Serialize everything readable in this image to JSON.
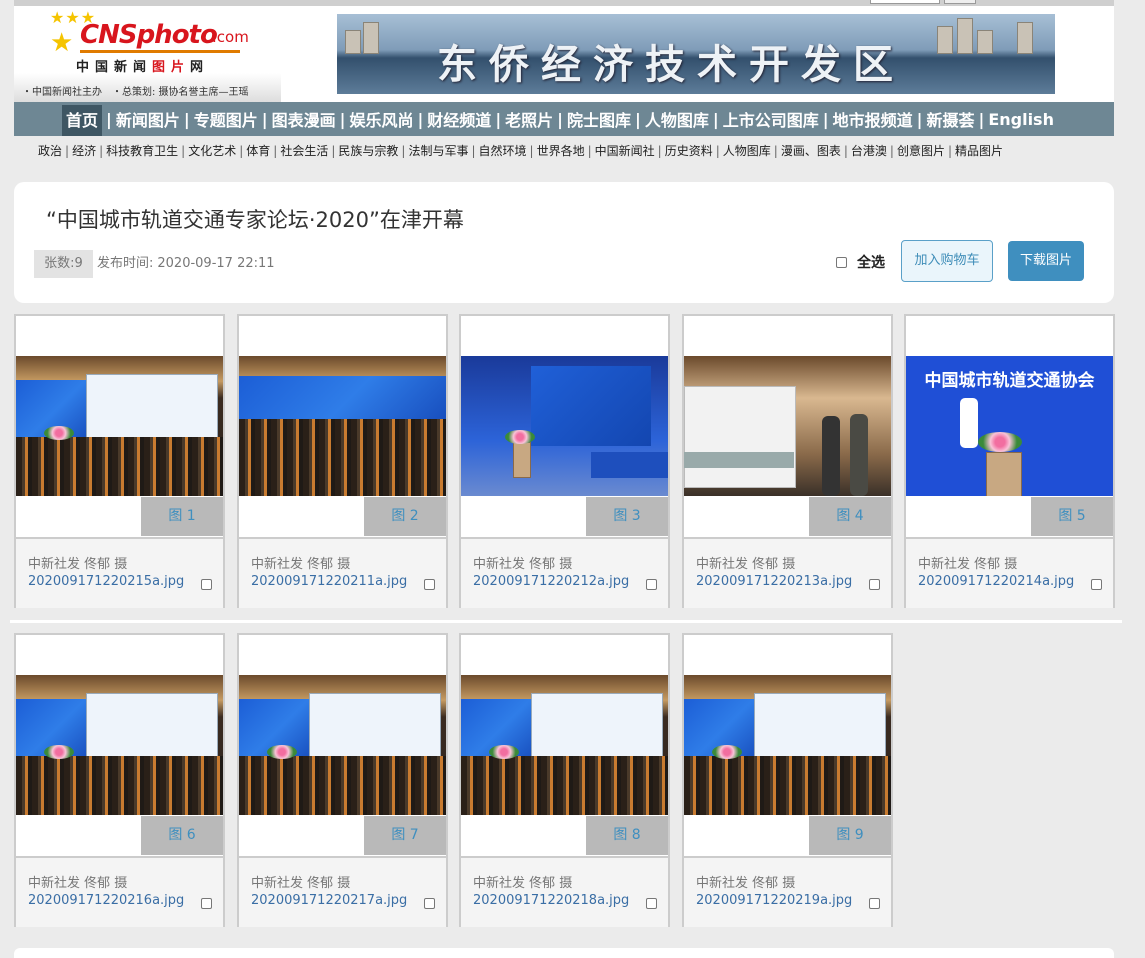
{
  "header": {
    "logo_brand": "CNSphoto",
    "logo_domain": ".com",
    "logo_cn_a": "中国新闻",
    "logo_cn_b": "图片",
    "logo_cn_c": "网",
    "logo_sub": "・中国新闻社主办　・总策划: 摄协名誉主席—王瑶",
    "banner_text": "东侨经济技术开发区"
  },
  "nav": {
    "items": [
      "首页",
      "新闻图片",
      "专题图片",
      "图表漫画",
      "娱乐风尚",
      "财经频道",
      "老照片",
      "院士图库",
      "人物图库",
      "上市公司图库",
      "地市报频道",
      "新摄荟",
      "English"
    ],
    "active_index": 0
  },
  "subnav": {
    "items": [
      "政治",
      "经济",
      "科技教育卫生",
      "文化艺术",
      "体育",
      "社会生活",
      "民族与宗教",
      "法制与军事",
      "自然环境",
      "世界各地",
      "中国新闻社",
      "历史资料",
      "人物图库",
      "漫画、图表",
      "台港澳",
      "创意图片",
      "精品图片"
    ]
  },
  "article": {
    "title": "“中国城市轨道交通专家论坛·2020”在津开幕",
    "count_label": "张数:9",
    "pub_label": "发布时间:",
    "pub_time": "2020-09-17 22:11",
    "select_all": "全选",
    "add_cart": "加入购物车",
    "download": "下载图片"
  },
  "photos": [
    {
      "fig": "图 1",
      "credit": "中新社发 佟郁 摄",
      "file": "202009171220215a.jpg",
      "checked": false
    },
    {
      "fig": "图 2",
      "credit": "中新社发 佟郁 摄",
      "file": "202009171220211a.jpg",
      "checked": false
    },
    {
      "fig": "图 3",
      "credit": "中新社发 佟郁 摄",
      "file": "202009171220212a.jpg",
      "checked": false
    },
    {
      "fig": "图 4",
      "credit": "中新社发 佟郁 摄",
      "file": "202009171220213a.jpg",
      "checked": false
    },
    {
      "fig": "图 5",
      "credit": "中新社发 佟郁 摄",
      "file": "202009171220214a.jpg",
      "checked": false
    },
    {
      "fig": "图 6",
      "credit": "中新社发 佟郁 摄",
      "file": "202009171220216a.jpg",
      "checked": false
    },
    {
      "fig": "图 7",
      "credit": "中新社发 佟郁 摄",
      "file": "202009171220217a.jpg",
      "checked": false
    },
    {
      "fig": "图 8",
      "credit": "中新社发 佟郁 摄",
      "file": "202009171220218a.jpg",
      "checked": false
    },
    {
      "fig": "图 9",
      "credit": "中新社发 佟郁 摄",
      "file": "202009171220219a.jpg",
      "checked": false
    }
  ],
  "photo5_screen_text": "中国城市轨道交通协会",
  "colors": {
    "nav_bg": "#6e8794",
    "accent": "#3f8fbf",
    "link": "#3a6ea5",
    "brand_red": "#d8151d"
  }
}
